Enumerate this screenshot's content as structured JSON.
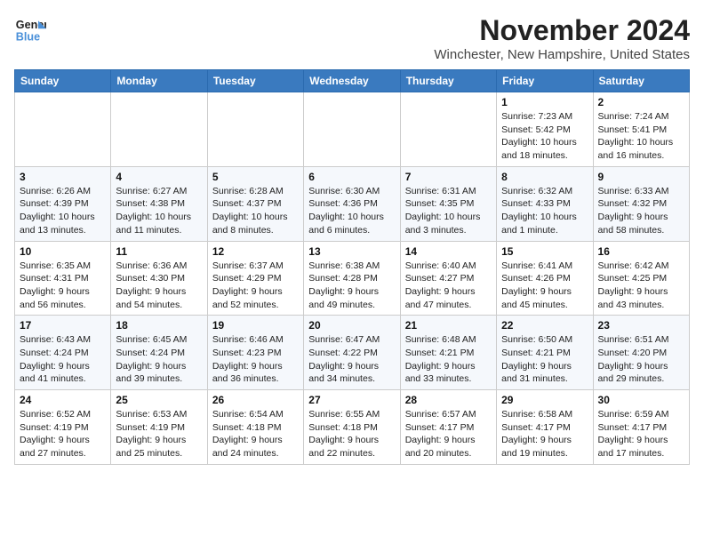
{
  "logo": {
    "line1": "General",
    "line2": "Blue"
  },
  "title": "November 2024",
  "location": "Winchester, New Hampshire, United States",
  "days_of_week": [
    "Sunday",
    "Monday",
    "Tuesday",
    "Wednesday",
    "Thursday",
    "Friday",
    "Saturday"
  ],
  "weeks": [
    [
      {
        "day": "",
        "info": ""
      },
      {
        "day": "",
        "info": ""
      },
      {
        "day": "",
        "info": ""
      },
      {
        "day": "",
        "info": ""
      },
      {
        "day": "",
        "info": ""
      },
      {
        "day": "1",
        "info": "Sunrise: 7:23 AM\nSunset: 5:42 PM\nDaylight: 10 hours and 18 minutes."
      },
      {
        "day": "2",
        "info": "Sunrise: 7:24 AM\nSunset: 5:41 PM\nDaylight: 10 hours and 16 minutes."
      }
    ],
    [
      {
        "day": "3",
        "info": "Sunrise: 6:26 AM\nSunset: 4:39 PM\nDaylight: 10 hours and 13 minutes."
      },
      {
        "day": "4",
        "info": "Sunrise: 6:27 AM\nSunset: 4:38 PM\nDaylight: 10 hours and 11 minutes."
      },
      {
        "day": "5",
        "info": "Sunrise: 6:28 AM\nSunset: 4:37 PM\nDaylight: 10 hours and 8 minutes."
      },
      {
        "day": "6",
        "info": "Sunrise: 6:30 AM\nSunset: 4:36 PM\nDaylight: 10 hours and 6 minutes."
      },
      {
        "day": "7",
        "info": "Sunrise: 6:31 AM\nSunset: 4:35 PM\nDaylight: 10 hours and 3 minutes."
      },
      {
        "day": "8",
        "info": "Sunrise: 6:32 AM\nSunset: 4:33 PM\nDaylight: 10 hours and 1 minute."
      },
      {
        "day": "9",
        "info": "Sunrise: 6:33 AM\nSunset: 4:32 PM\nDaylight: 9 hours and 58 minutes."
      }
    ],
    [
      {
        "day": "10",
        "info": "Sunrise: 6:35 AM\nSunset: 4:31 PM\nDaylight: 9 hours and 56 minutes."
      },
      {
        "day": "11",
        "info": "Sunrise: 6:36 AM\nSunset: 4:30 PM\nDaylight: 9 hours and 54 minutes."
      },
      {
        "day": "12",
        "info": "Sunrise: 6:37 AM\nSunset: 4:29 PM\nDaylight: 9 hours and 52 minutes."
      },
      {
        "day": "13",
        "info": "Sunrise: 6:38 AM\nSunset: 4:28 PM\nDaylight: 9 hours and 49 minutes."
      },
      {
        "day": "14",
        "info": "Sunrise: 6:40 AM\nSunset: 4:27 PM\nDaylight: 9 hours and 47 minutes."
      },
      {
        "day": "15",
        "info": "Sunrise: 6:41 AM\nSunset: 4:26 PM\nDaylight: 9 hours and 45 minutes."
      },
      {
        "day": "16",
        "info": "Sunrise: 6:42 AM\nSunset: 4:25 PM\nDaylight: 9 hours and 43 minutes."
      }
    ],
    [
      {
        "day": "17",
        "info": "Sunrise: 6:43 AM\nSunset: 4:24 PM\nDaylight: 9 hours and 41 minutes."
      },
      {
        "day": "18",
        "info": "Sunrise: 6:45 AM\nSunset: 4:24 PM\nDaylight: 9 hours and 39 minutes."
      },
      {
        "day": "19",
        "info": "Sunrise: 6:46 AM\nSunset: 4:23 PM\nDaylight: 9 hours and 36 minutes."
      },
      {
        "day": "20",
        "info": "Sunrise: 6:47 AM\nSunset: 4:22 PM\nDaylight: 9 hours and 34 minutes."
      },
      {
        "day": "21",
        "info": "Sunrise: 6:48 AM\nSunset: 4:21 PM\nDaylight: 9 hours and 33 minutes."
      },
      {
        "day": "22",
        "info": "Sunrise: 6:50 AM\nSunset: 4:21 PM\nDaylight: 9 hours and 31 minutes."
      },
      {
        "day": "23",
        "info": "Sunrise: 6:51 AM\nSunset: 4:20 PM\nDaylight: 9 hours and 29 minutes."
      }
    ],
    [
      {
        "day": "24",
        "info": "Sunrise: 6:52 AM\nSunset: 4:19 PM\nDaylight: 9 hours and 27 minutes."
      },
      {
        "day": "25",
        "info": "Sunrise: 6:53 AM\nSunset: 4:19 PM\nDaylight: 9 hours and 25 minutes."
      },
      {
        "day": "26",
        "info": "Sunrise: 6:54 AM\nSunset: 4:18 PM\nDaylight: 9 hours and 24 minutes."
      },
      {
        "day": "27",
        "info": "Sunrise: 6:55 AM\nSunset: 4:18 PM\nDaylight: 9 hours and 22 minutes."
      },
      {
        "day": "28",
        "info": "Sunrise: 6:57 AM\nSunset: 4:17 PM\nDaylight: 9 hours and 20 minutes."
      },
      {
        "day": "29",
        "info": "Sunrise: 6:58 AM\nSunset: 4:17 PM\nDaylight: 9 hours and 19 minutes."
      },
      {
        "day": "30",
        "info": "Sunrise: 6:59 AM\nSunset: 4:17 PM\nDaylight: 9 hours and 17 minutes."
      }
    ]
  ]
}
